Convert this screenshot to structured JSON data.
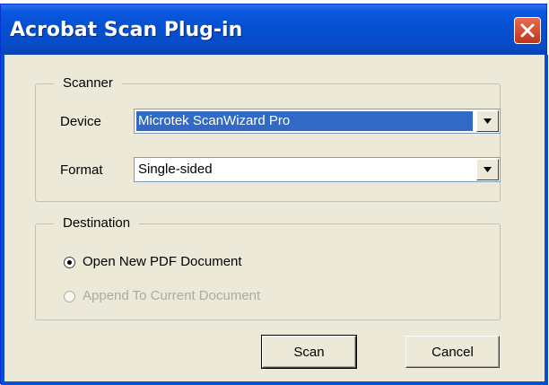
{
  "window": {
    "title": "Acrobat Scan Plug-in"
  },
  "scanner": {
    "legend": "Scanner",
    "device_label": "Device",
    "device_value": "Microtek ScanWizard Pro",
    "format_label": "Format",
    "format_value": "Single-sided"
  },
  "destination": {
    "legend": "Destination",
    "options": [
      {
        "label": "Open New PDF Document",
        "selected": true,
        "enabled": true
      },
      {
        "label": "Append To Current Document",
        "selected": false,
        "enabled": false
      }
    ]
  },
  "buttons": {
    "scan_label": "Scan",
    "cancel_label": "Cancel"
  },
  "colors": {
    "titlebar": "#0450d0",
    "dialog_bg": "#ece9d8",
    "close_button": "#d84a2c",
    "selection": "#316ac5",
    "disabled_text": "#acaba1"
  }
}
